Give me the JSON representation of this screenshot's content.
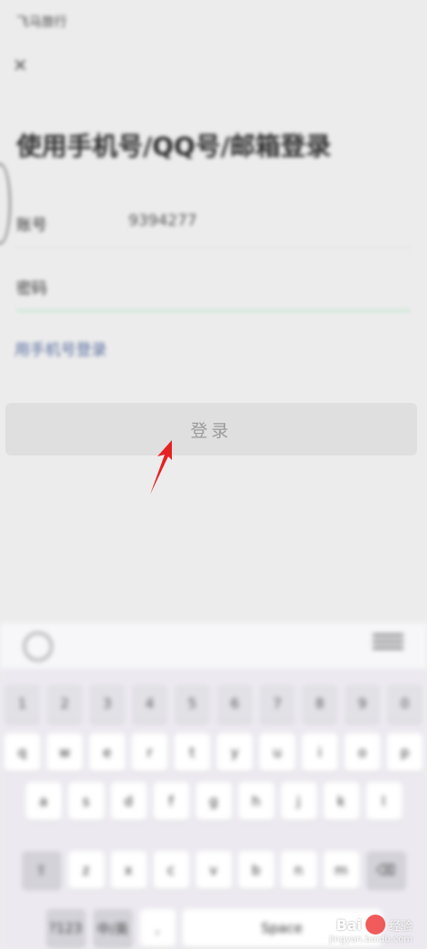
{
  "status": {
    "left": "飞马旅行",
    "right": ""
  },
  "page": {
    "close_icon": "close-icon",
    "title": "使用手机号/QQ号/邮箱登录",
    "account_label": "账号",
    "account_value": "9394277",
    "password_label": "密码",
    "password_placeholder": "",
    "sms_link": "用手机号登录",
    "login_button": "登录"
  },
  "annotation": {
    "arrow_color": "#e52222"
  },
  "keyboard": {
    "numbers": [
      "1",
      "2",
      "3",
      "4",
      "5",
      "6",
      "7",
      "8",
      "9",
      "0"
    ],
    "row1": [
      "q",
      "w",
      "e",
      "r",
      "t",
      "y",
      "u",
      "i",
      "o",
      "p"
    ],
    "row2": [
      "a",
      "s",
      "d",
      "f",
      "g",
      "h",
      "j",
      "k",
      "l"
    ],
    "row3": [
      "z",
      "x",
      "c",
      "v",
      "b",
      "n",
      "m"
    ],
    "space_label": "Space",
    "shift_icon": "shift-icon",
    "delete_icon": "delete-icon",
    "mode_label": "?123",
    "lang_label": "中/英",
    "punct_label": ","
  },
  "watermark": {
    "brand": "Bai",
    "suffix": "经验",
    "site": "jingyan.baidu.com"
  }
}
